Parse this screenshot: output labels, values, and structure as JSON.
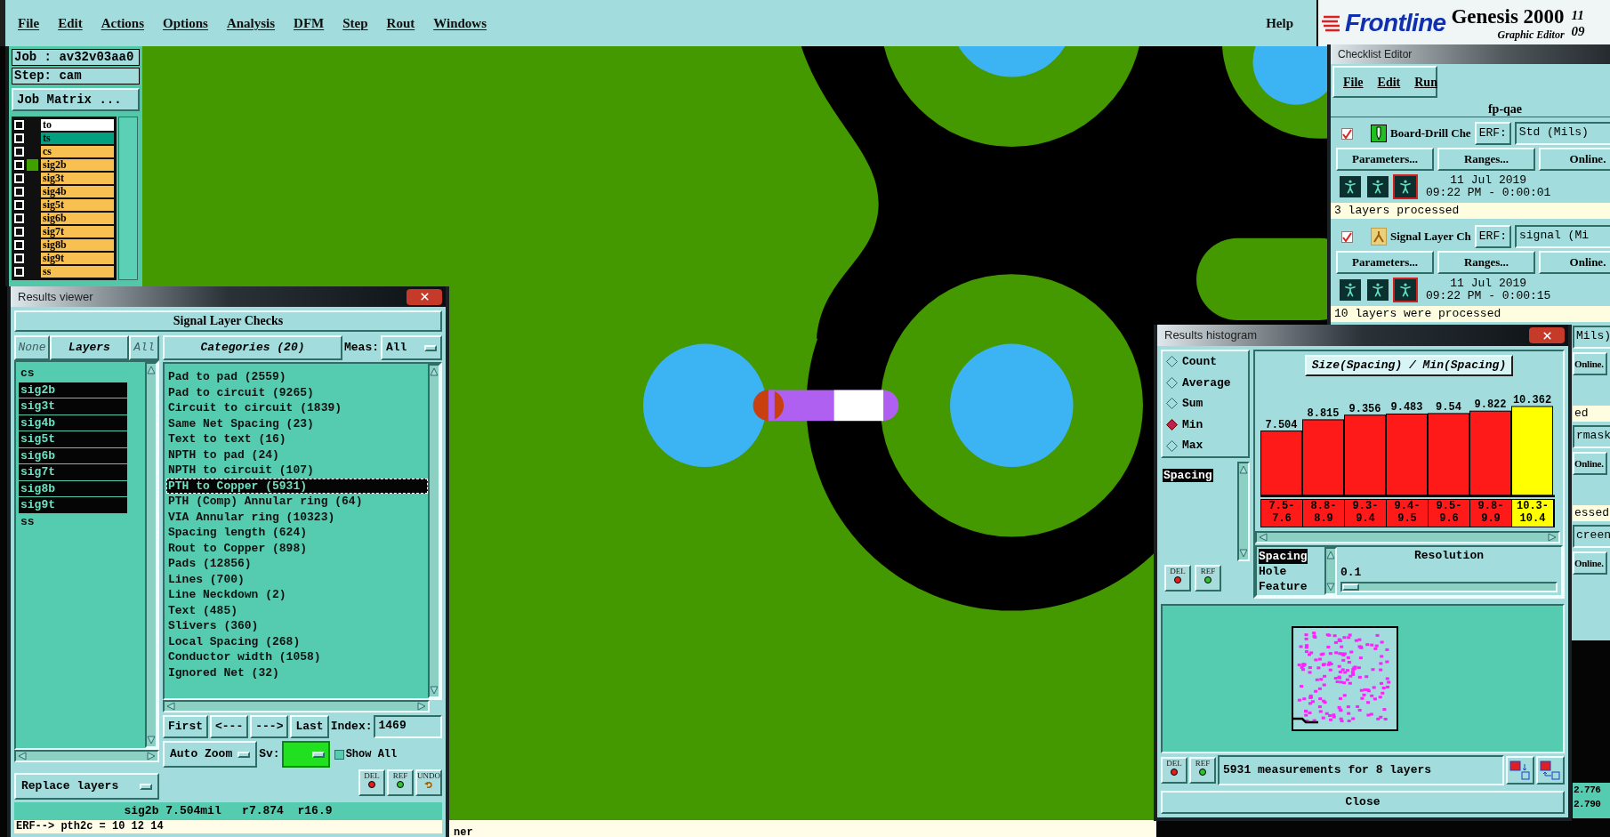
{
  "menu_bar": {
    "items": [
      "File",
      "Edit",
      "Actions",
      "Options",
      "Analysis",
      "DFM",
      "Step",
      "Rout",
      "Windows"
    ],
    "help": "Help"
  },
  "logo": {
    "brand": "Frontline",
    "product": "Genesis 2000",
    "subtitle": "Graphic Editor",
    "corner_lines": [
      "11",
      "09"
    ]
  },
  "job_panel": {
    "job": "Job : av32v03aa0",
    "step": "Step: cam",
    "job_matrix_button": "Job Matrix ...",
    "layers": [
      {
        "name": "to",
        "color": "#ffffff",
        "active": false,
        "checked": false
      },
      {
        "name": "ts",
        "color": "#00a080",
        "active": false,
        "checked": false
      },
      {
        "name": "cs",
        "color": "#f8c050",
        "active": false,
        "checked": false
      },
      {
        "name": "sig2b",
        "color": "#f8c050",
        "active": true,
        "checked": false
      },
      {
        "name": "sig3t",
        "color": "#f8c050",
        "active": false,
        "checked": false
      },
      {
        "name": "sig4b",
        "color": "#f8c050",
        "active": false,
        "checked": false
      },
      {
        "name": "sig5t",
        "color": "#f8c050",
        "active": false,
        "checked": false
      },
      {
        "name": "sig6b",
        "color": "#f8c050",
        "active": false,
        "checked": false
      },
      {
        "name": "sig7t",
        "color": "#f8c050",
        "active": false,
        "checked": false
      },
      {
        "name": "sig8b",
        "color": "#f8c050",
        "active": false,
        "checked": false
      },
      {
        "name": "sig9t",
        "color": "#f8c050",
        "active": false,
        "checked": false
      },
      {
        "name": "ss",
        "color": "#f8c050",
        "active": false,
        "checked": false
      }
    ]
  },
  "results_viewer": {
    "title": "Results viewer",
    "header": "Signal Layer Checks",
    "none_button": "None",
    "layers_button": "Layers",
    "all_button": "All",
    "layers": [
      {
        "name": "cs",
        "selected": false
      },
      {
        "name": "sig2b",
        "selected": true
      },
      {
        "name": "sig3t",
        "selected": true
      },
      {
        "name": "sig4b",
        "selected": true
      },
      {
        "name": "sig5t",
        "selected": true
      },
      {
        "name": "sig6b",
        "selected": true
      },
      {
        "name": "sig7t",
        "selected": true
      },
      {
        "name": "sig8b",
        "selected": true
      },
      {
        "name": "sig9t",
        "selected": true
      },
      {
        "name": "ss",
        "selected": false
      }
    ],
    "categories_button": "Categories (20)",
    "meas_label": "Meas:",
    "meas_value": "All",
    "categories": [
      {
        "label": "Pad to pad (2559)",
        "selected": false
      },
      {
        "label": "Pad to circuit (9265)",
        "selected": false
      },
      {
        "label": "Circuit to circuit (1839)",
        "selected": false
      },
      {
        "label": "Same Net Spacing (23)",
        "selected": false
      },
      {
        "label": "Text to text (16)",
        "selected": false
      },
      {
        "label": "NPTH to pad (24)",
        "selected": false
      },
      {
        "label": "NPTH to circuit (107)",
        "selected": false
      },
      {
        "label": "PTH to Copper (5931)",
        "selected": true
      },
      {
        "label": "PTH (Comp) Annular ring (64)",
        "selected": false
      },
      {
        "label": "VIA Annular ring (10323)",
        "selected": false
      },
      {
        "label": "Spacing length (624)",
        "selected": false
      },
      {
        "label": "Rout to Copper (898)",
        "selected": false
      },
      {
        "label": "Pads (12856)",
        "selected": false
      },
      {
        "label": "Lines (700)",
        "selected": false
      },
      {
        "label": "Line Neckdown (2)",
        "selected": false
      },
      {
        "label": "Text (485)",
        "selected": false
      },
      {
        "label": "Slivers (360)",
        "selected": false
      },
      {
        "label": "Local Spacing (268)",
        "selected": false
      },
      {
        "label": "Conductor width (1058)",
        "selected": false
      },
      {
        "label": "Ignored Net (32)",
        "selected": false
      }
    ],
    "nav_buttons": [
      "First",
      "<---",
      "--->",
      "Last"
    ],
    "index_label": "Index:",
    "index_value": "1469",
    "zoom_mode": "Auto Zoom",
    "sv_label": "Sv:",
    "show_all": {
      "label": "Show All",
      "checked": false
    },
    "replace_mode": "Replace layers",
    "tool_buttons": [
      {
        "label": "DEL",
        "kind": "delete"
      },
      {
        "label": "REF",
        "kind": "refresh"
      },
      {
        "label": "UNDO",
        "kind": "undo"
      }
    ],
    "status": "sig2b 7.504mil   r7.874  r16.9",
    "erf_line": "ERF--> pth2c = 10 12 14"
  },
  "status_tail": "ner",
  "checklist_editor": {
    "title": "Checklist Editor",
    "menu": [
      "File",
      "Edit",
      "Run"
    ],
    "name": "fp-qae",
    "entries": [
      {
        "name": "Board-Drill Che",
        "kind": "drill",
        "checked": true,
        "erf_label": "ERF:",
        "erf_value": "Std (Mils)",
        "buttons": [
          "Parameters...",
          "Ranges...",
          "Online."
        ],
        "date": "11 Jul 2019",
        "time": "09:22 PM - 0:00:01",
        "message": "3 layers processed"
      },
      {
        "name": "Signal Layer Ch",
        "kind": "signal",
        "checked": true,
        "erf_label": "ERF:",
        "erf_value": "signal (Mi",
        "buttons": [
          "Parameters...",
          "Ranges...",
          "Online."
        ],
        "date": "11 Jul 2019",
        "time": "09:22 PM - 0:00:15",
        "message": "10 layers were processed"
      }
    ],
    "covered_entries": [
      {
        "erf_value": "Mils)",
        "online": "Online.",
        "message": "ed"
      },
      {
        "erf_value": "rmask",
        "online": "Online.",
        "message": "essed"
      },
      {
        "erf_value": "creen",
        "online": "Online."
      }
    ]
  },
  "results_histogram": {
    "title": "Results histogram",
    "modes": [
      {
        "label": "Count",
        "selected": false
      },
      {
        "label": "Average",
        "selected": false
      },
      {
        "label": "Sum",
        "selected": false
      },
      {
        "label": "Min",
        "selected": true
      },
      {
        "label": "Max",
        "selected": false
      }
    ],
    "measures": [
      {
        "label": "Spacing",
        "selected": true
      }
    ],
    "list_tool_buttons": [
      {
        "label": "DEL",
        "kind": "delete"
      },
      {
        "label": "REF",
        "kind": "refresh"
      }
    ],
    "chart_data": {
      "type": "bar",
      "title": "Size(Spacing) / Min(Spacing)",
      "categories": [
        "7.5-7.6",
        "8.8-8.9",
        "9.3-9.4",
        "9.4-9.5",
        "9.5-9.6",
        "9.8-9.9",
        "10.3-10.4"
      ],
      "values": [
        7.504,
        8.815,
        9.356,
        9.483,
        9.54,
        9.822,
        10.362
      ],
      "ylim": [
        0,
        10.362
      ],
      "data_labels": true
    },
    "bins": [
      {
        "selected": false
      },
      {
        "selected": false
      },
      {
        "selected": false
      },
      {
        "selected": false
      },
      {
        "selected": false
      },
      {
        "selected": false
      },
      {
        "selected": true
      }
    ],
    "attributes": [
      {
        "label": "Spacing",
        "selected": true
      },
      {
        "label": "Hole",
        "selected": false
      },
      {
        "label": "Feature",
        "selected": false
      }
    ],
    "resolution_label": "Resolution",
    "resolution_value": "0.1",
    "resolution_slider": {
      "level": 0.08
    },
    "bottom_tool_buttons": [
      {
        "label": "DEL",
        "kind": "delete"
      },
      {
        "label": "REF",
        "kind": "refresh"
      }
    ],
    "summary": "5931 measurements for 8 layers",
    "close_button": "Close"
  },
  "side_readings": [
    "2.776",
    "2.790"
  ]
}
